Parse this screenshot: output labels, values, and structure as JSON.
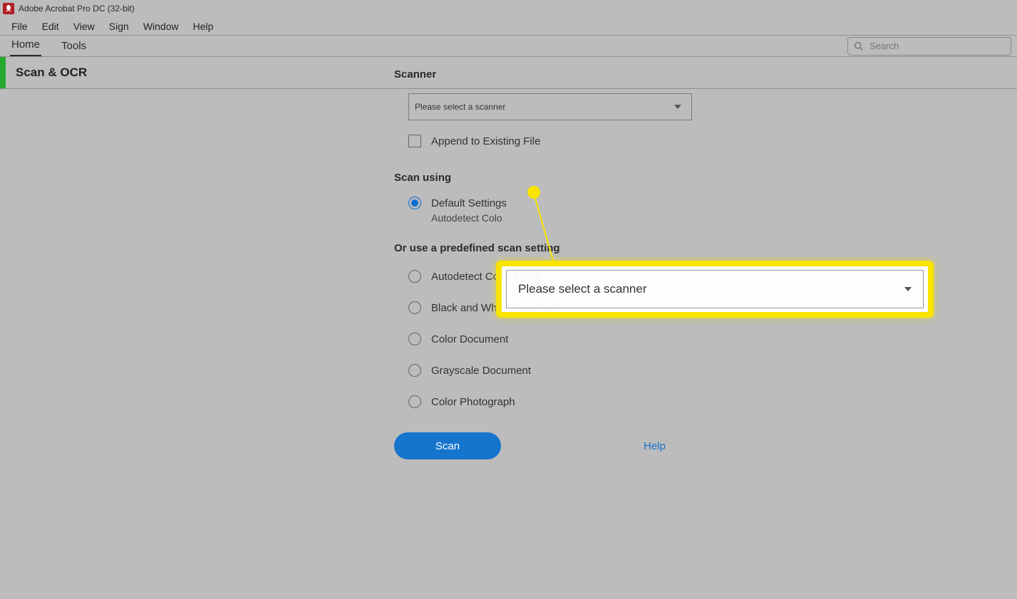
{
  "window": {
    "title": "Adobe Acrobat Pro DC (32-bit)"
  },
  "menu": {
    "items": [
      "File",
      "Edit",
      "View",
      "Sign",
      "Window",
      "Help"
    ]
  },
  "tabs": {
    "home": "Home",
    "tools": "Tools"
  },
  "search": {
    "placeholder": "Search"
  },
  "tool": {
    "title": "Scan & OCR"
  },
  "form": {
    "scanner_label": "Scanner",
    "scanner_dropdown": "Please select a scanner",
    "append_label": "Append to Existing File",
    "scan_using_label": "Scan using",
    "default_settings": "Default Settings",
    "default_sub": "Autodetect Colo",
    "predefined_label": "Or use a predefined scan setting",
    "options": {
      "auto": "Autodetect Color Mode",
      "bw": "Black and White Document",
      "color": "Color Document",
      "gray": "Grayscale Document",
      "photo": "Color Photograph"
    },
    "scan_btn": "Scan",
    "help": "Help"
  },
  "callout": {
    "text": "Please select a scanner"
  }
}
